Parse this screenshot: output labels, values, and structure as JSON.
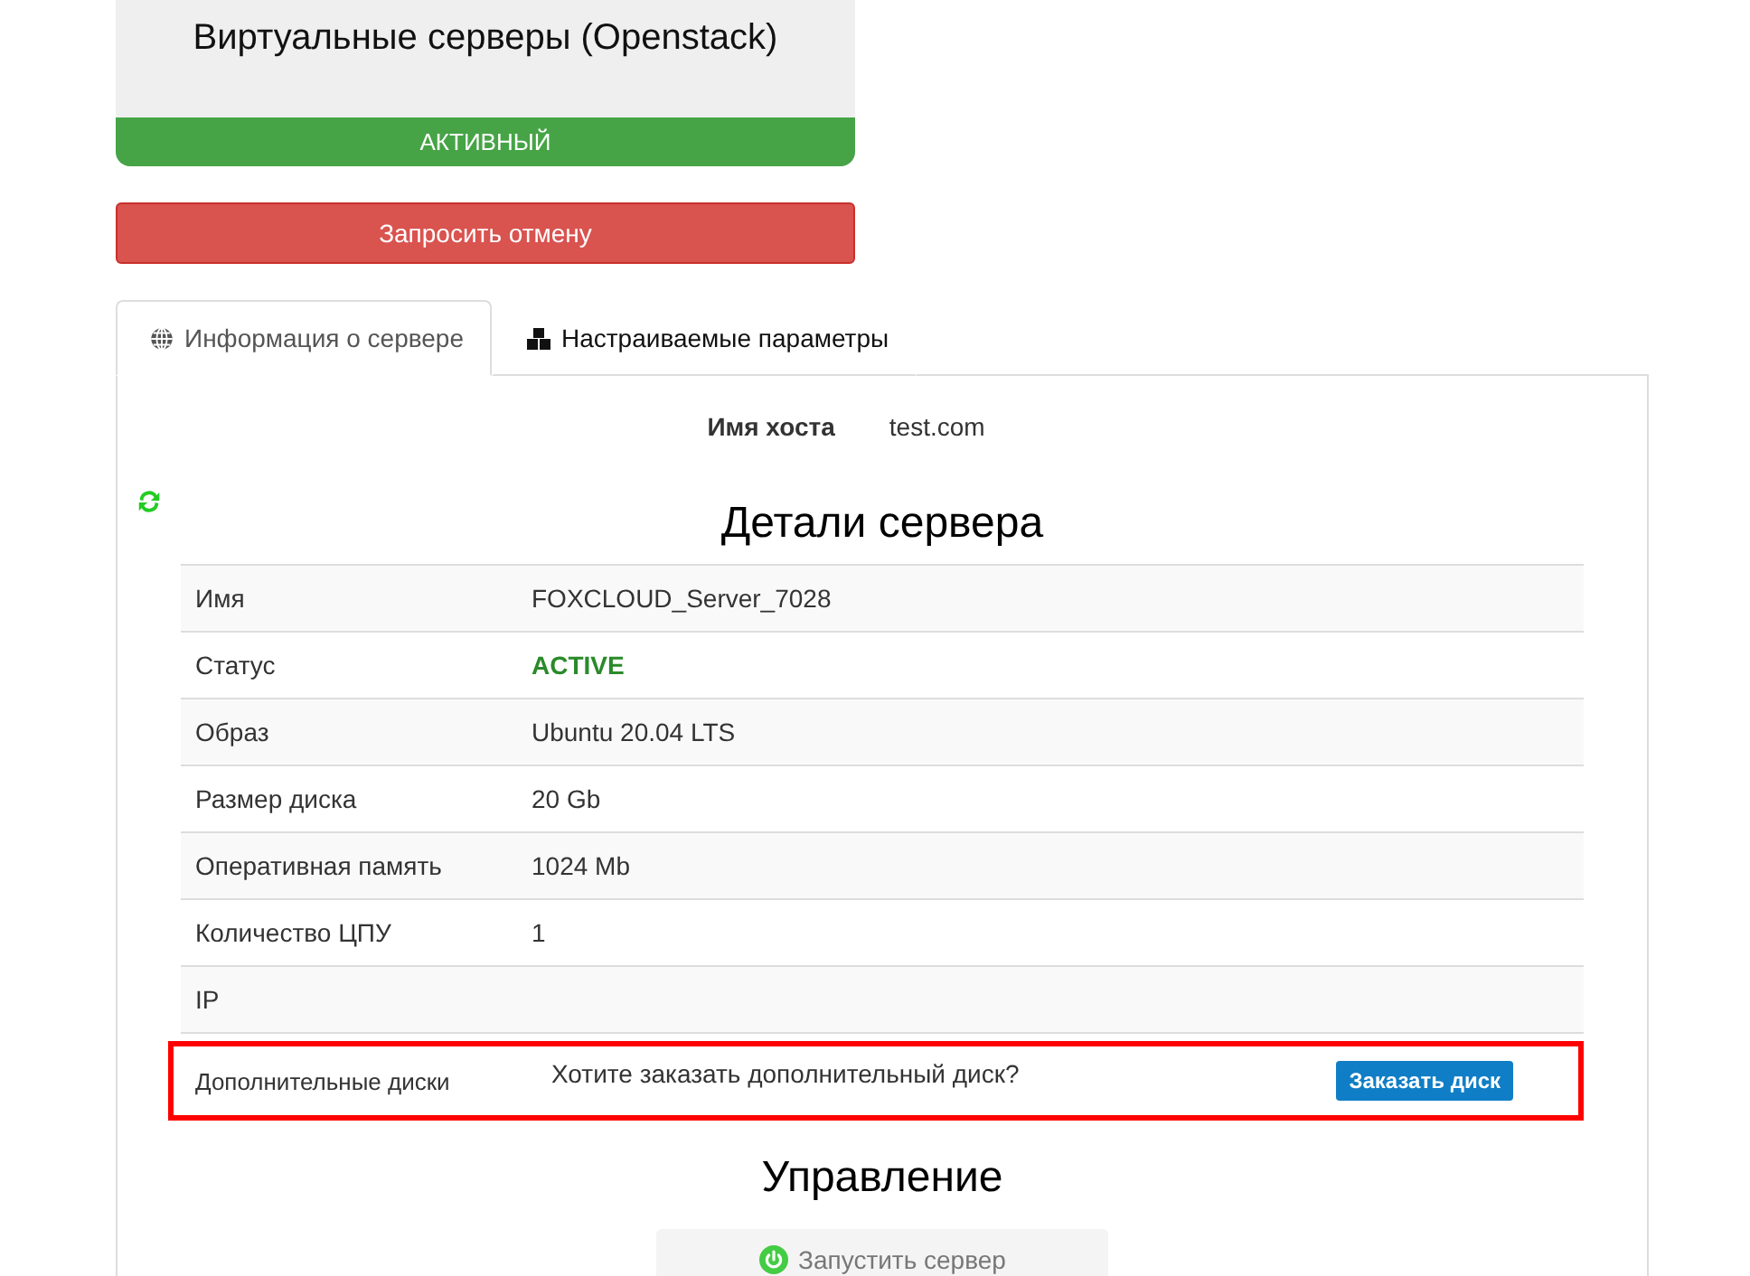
{
  "service_card": {
    "title": "Виртуальные серверы (Openstack)",
    "status": "АКТИВНЫЙ"
  },
  "cancel_button": "Запросить отмену",
  "tabs": [
    {
      "label": "Информация о сервере",
      "kind": "globe",
      "selected": true
    },
    {
      "label": "Настраиваемые параметры",
      "kind": "cubes",
      "selected": false
    }
  ],
  "hostname": {
    "label": "Имя хоста",
    "value": "test.com"
  },
  "details": {
    "title": "Детали сервера",
    "rows": [
      {
        "label": "Имя",
        "value": "FOXCLOUD_Server_7028",
        "kind": "text"
      },
      {
        "label": "Статус",
        "value": "ACTIVE",
        "kind": "status"
      },
      {
        "label": "Образ",
        "value": "Ubuntu 20.04 LTS",
        "kind": "text"
      },
      {
        "label": "Размер диска",
        "value": "20 Gb",
        "kind": "text"
      },
      {
        "label": "Оперативная память",
        "value": "1024 Mb",
        "kind": "text"
      },
      {
        "label": "Количество ЦПУ",
        "value": "1",
        "kind": "text"
      },
      {
        "label": "IP",
        "kind": "text"
      }
    ],
    "extra_disks": {
      "label": "Дополнительные диски",
      "question": "Хотите заказать дополнительный диск?",
      "button": "Заказать диск",
      "highlighted": true
    }
  },
  "management": {
    "title": "Управление",
    "start_button": "Запустить сервер"
  }
}
